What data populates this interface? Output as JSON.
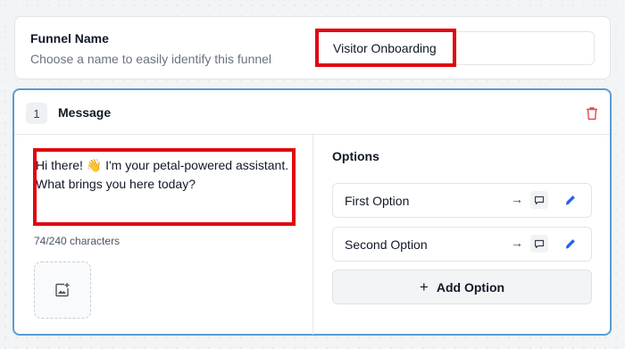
{
  "funnel": {
    "label": "Funnel Name",
    "description": "Choose a name to easily identify this funnel",
    "name_value": "Visitor Onboarding"
  },
  "message_step": {
    "number": "1",
    "title": "Message",
    "text": "Hi there! 👋 I'm your petal-powered assistant. What brings you here today?",
    "char_count": "74/240 characters"
  },
  "options": {
    "title": "Options",
    "items": [
      {
        "label": "First Option",
        "arrow": "→"
      },
      {
        "label": "Second Option",
        "arrow": "→"
      }
    ],
    "add_label": "Add Option",
    "add_icon": "+"
  },
  "icons": {
    "delete": "trash-icon",
    "image_upload": "image-add-icon",
    "target": "chat-bubble-icon",
    "edit": "pencil-icon"
  },
  "colors": {
    "highlight": "#e0080f",
    "active_border": "#5b9bd5",
    "delete": "#e5484d",
    "edit": "#2563eb"
  }
}
